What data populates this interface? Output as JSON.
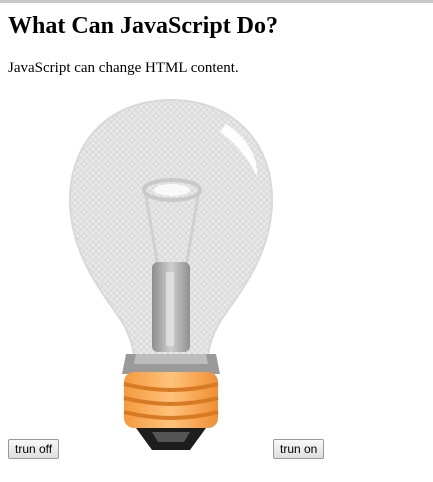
{
  "page": {
    "title": "What Can JavaScript Do?",
    "intro": "JavaScript can change HTML content."
  },
  "image": {
    "icon": "lightbulb-off-icon",
    "state": "off"
  },
  "buttons": {
    "turn_off_label": "trun off",
    "turn_on_label": "trun on"
  },
  "colors": {
    "bulb_glass": "#e6e6e6",
    "bulb_base": "#f6a24c",
    "bulb_tip": "#1a1a1a",
    "button_border": "#9a9a9a"
  }
}
